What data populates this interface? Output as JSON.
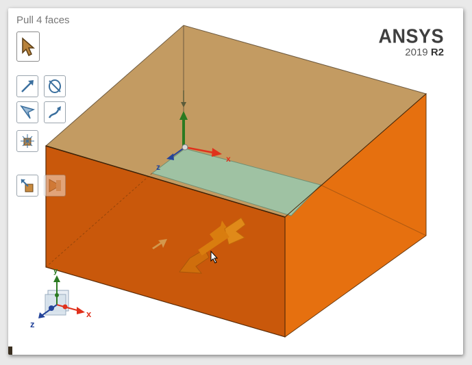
{
  "viewport": {
    "title": "Pull 4 faces"
  },
  "brand": {
    "name": "ANSYS",
    "version_year": "2019",
    "version_release": "R2"
  },
  "local_axes": {
    "x_label": "x",
    "z_label": "z"
  },
  "triad": {
    "x_label": "x",
    "y_label": "y",
    "z_label": "z"
  },
  "toolbar": {
    "tools": [
      {
        "name": "select",
        "icon": "select-arrow-icon"
      },
      {
        "name": "pull-direction",
        "icon": "pull-direction-icon"
      },
      {
        "name": "revolve",
        "icon": "revolve-icon"
      },
      {
        "name": "up-to",
        "icon": "up-to-icon"
      },
      {
        "name": "sweep",
        "icon": "sweep-icon"
      },
      {
        "name": "pivot",
        "icon": "pivot-icon"
      },
      {
        "name": "full-pull",
        "icon": "full-pull-icon"
      },
      {
        "name": "complete",
        "icon": "complete-icon",
        "disabled": true
      }
    ]
  },
  "colors": {
    "top_face": "#c39b62",
    "front_face": "#c9580b",
    "right_face": "#e6700f",
    "selected_face": "#9fc2a3",
    "pull_arrow": "#d97d0f",
    "axis_x": "#e0311c",
    "axis_y": "#2b7a21",
    "axis_z": "#24449a"
  }
}
